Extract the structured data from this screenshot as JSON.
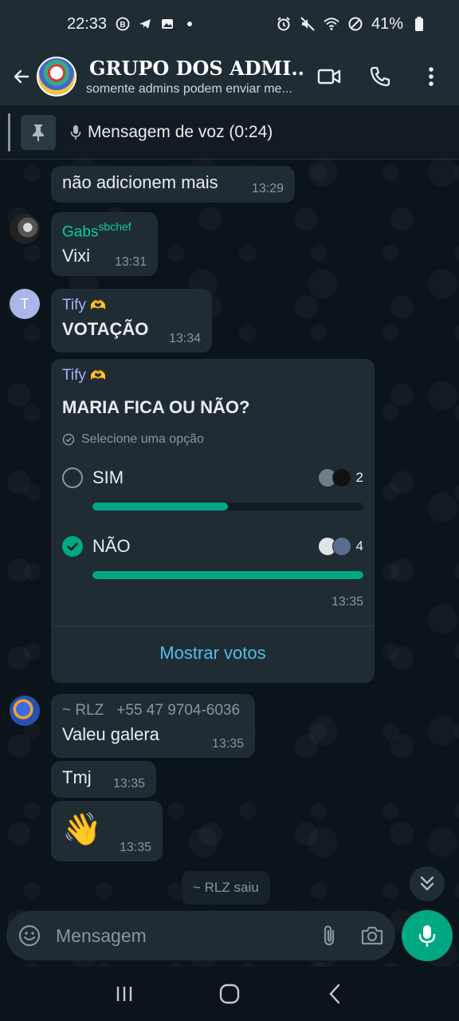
{
  "status_bar": {
    "time": "22:33",
    "battery": "41%",
    "left_icons": [
      "b-circle-icon",
      "telegram-icon",
      "gallery-icon",
      "dot-icon"
    ],
    "right_icons": [
      "alarm-icon",
      "mute-icon",
      "wifi-icon",
      "dnd-icon",
      "battery-icon"
    ]
  },
  "header": {
    "group_name": "GRUPO DOS ADMI...",
    "subtitle": "somente admins podem enviar me...",
    "lock_icon": "lock-icon"
  },
  "pinned": {
    "text": "Mensagem de voz (0:24)"
  },
  "messages": [
    {
      "text": "não adicionem mais",
      "time": "13:29"
    },
    {
      "sender": "Gabs",
      "sender_suffix": "sbchef",
      "sender_color": "#06cf9c",
      "text": "Vixi",
      "time": "13:31"
    },
    {
      "sender": "Tify",
      "sender_emoji": "🫶",
      "sender_color": "#a5b4fc",
      "avatar_letter": "T",
      "text": "VOTAÇÃO",
      "time": "13:34"
    }
  ],
  "poll": {
    "sender": "Tify",
    "sender_emoji": "🫶",
    "question": "MARIA FICA OU NÃO?",
    "hint": "Selecione uma opção",
    "options": [
      {
        "label": "SIM",
        "votes": "2",
        "fraction": 0.5,
        "checked": false
      },
      {
        "label": "NÃO",
        "votes": "4",
        "fraction": 1.0,
        "checked": true
      }
    ],
    "time": "13:35",
    "show_votes": "Mostrar votos"
  },
  "messages2": [
    {
      "sender": "~ RLZ",
      "phone": "+55 47 9704-6036",
      "text": "Valeu galera",
      "time": "13:35"
    },
    {
      "text": "Tmj",
      "time": "13:35"
    },
    {
      "text": "👋",
      "time": "13:35"
    }
  ],
  "system_note": "~ RLZ saiu",
  "composer": {
    "placeholder": "Mensagem"
  },
  "colors": {
    "accent": "#00a884",
    "link": "#53bdeb",
    "bubble": "#202c33",
    "background": "#0b141a"
  }
}
